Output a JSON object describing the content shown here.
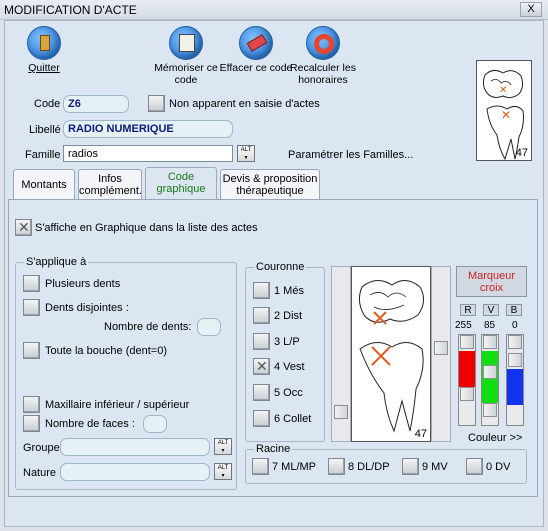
{
  "window": {
    "title": "MODIFICATION D'ACTE",
    "close_label": "X"
  },
  "toolbar": [
    {
      "label_html": "Quitter",
      "icon": "exit-door-icon"
    },
    {
      "label": "Mémoriser ce code",
      "icon": "memorize-icon"
    },
    {
      "label": "Effacer ce code",
      "icon": "eraser-icon"
    },
    {
      "label": "Recalculer les honoraires",
      "icon": "lifebuoy-icon"
    }
  ],
  "form": {
    "code_label": "Code",
    "code_value": "Z6",
    "non_apparent_label": "Non apparent en saisie d'actes",
    "libelle_label": "Libellé",
    "libelle_value": "RADIO NUMERIQUE",
    "famille_label": "Famille",
    "famille_value": "radios",
    "alt_label": "ALT",
    "parametrer_label": "Paramétrer les Familles..."
  },
  "preview_tooth_number": "47",
  "tabs": [
    {
      "label": "Montants"
    },
    {
      "label": "Infos complément."
    },
    {
      "label": "Code graphique",
      "active": true
    },
    {
      "label": "Devis & proposition thérapeutique"
    }
  ],
  "panel": {
    "graph_check_label": "S'affiche en Graphique dans la liste des actes",
    "applique_title": "S'applique à",
    "plusieurs_dents": "Plusieurs dents",
    "dents_disjointes": "Dents disjointes :",
    "nombre_dents": "Nombre de dents:",
    "toute_bouche": "Toute la bouche (dent=0)",
    "maxillaire": "Maxillaire inférieur / supérieur",
    "nombre_faces": "Nombre de faces :",
    "groupe_label": "Groupe",
    "nature_label": "Nature",
    "couronne_title": "Couronne",
    "couronne_items": [
      "1 Més",
      "2 Dist",
      "3 L/P",
      "4 Vest",
      "5 Occ",
      "6 Collet"
    ],
    "racine_title": "Racine",
    "racine_items": [
      "7 ML/MP",
      "8 DL/DP",
      "9 MV",
      "0 DV"
    ],
    "tooth_number": "47",
    "marqueur_label": "Marqueur croix",
    "rgb_headers": [
      "R",
      "V",
      "B"
    ],
    "rgb_values": [
      "255",
      "85",
      "0"
    ],
    "couleur_link": "Couleur >>"
  }
}
